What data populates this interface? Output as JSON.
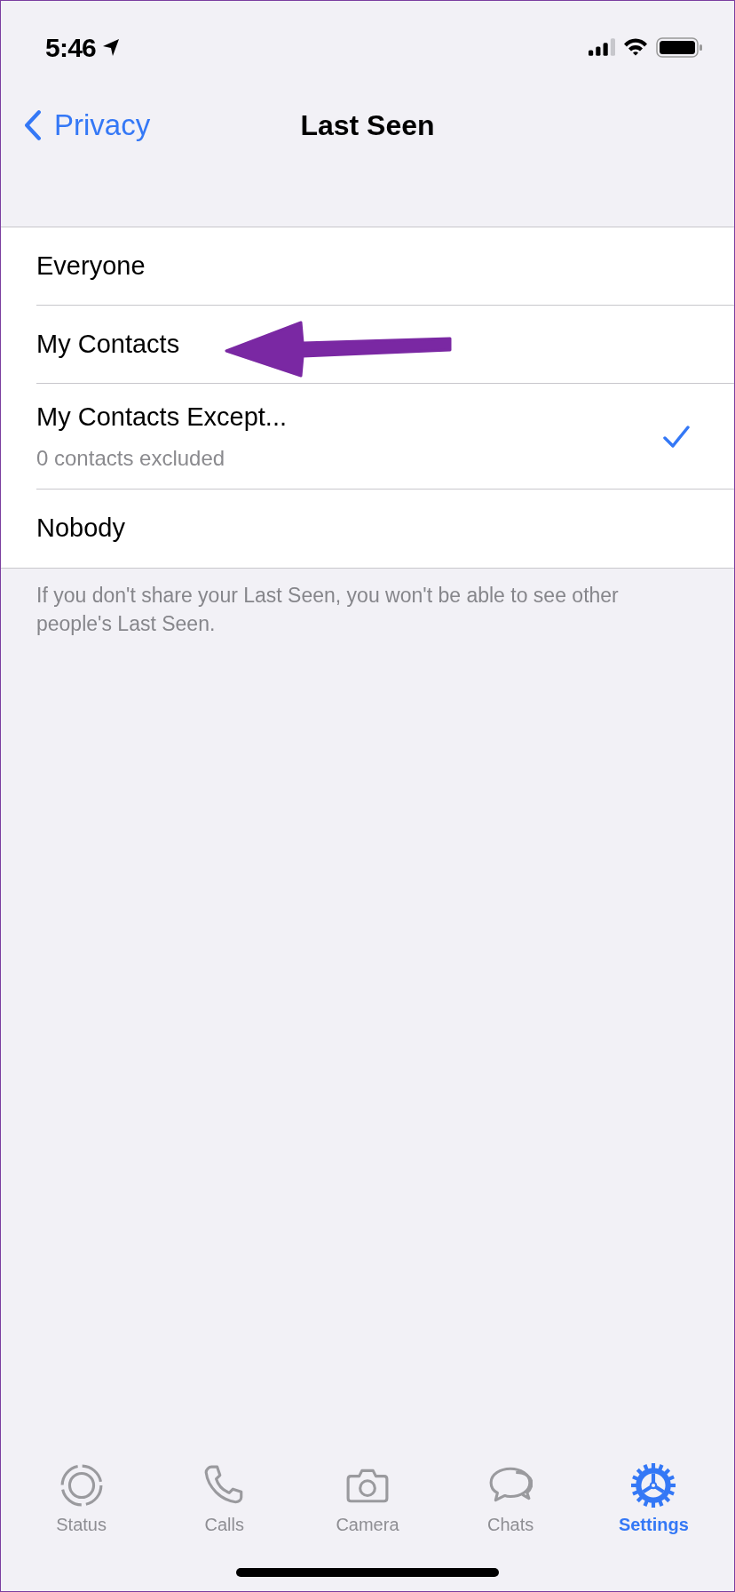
{
  "status_bar": {
    "time": "5:46"
  },
  "nav": {
    "back_label": "Privacy",
    "title": "Last Seen"
  },
  "options": [
    {
      "label": "Everyone",
      "selected": false
    },
    {
      "label": "My Contacts",
      "selected": false
    },
    {
      "label": "My Contacts Except...",
      "subtitle": "0 contacts excluded",
      "selected": true
    },
    {
      "label": "Nobody",
      "selected": false
    }
  ],
  "footer_note": "If you don't share your Last Seen, you won't be able to see other people's Last Seen.",
  "tab_bar": [
    {
      "label": "Status",
      "kind": "status",
      "selected": false
    },
    {
      "label": "Calls",
      "kind": "calls",
      "selected": false
    },
    {
      "label": "Camera",
      "kind": "camera",
      "selected": false
    },
    {
      "label": "Chats",
      "kind": "chats",
      "selected": false
    },
    {
      "label": "Settings",
      "kind": "settings",
      "selected": true
    }
  ]
}
